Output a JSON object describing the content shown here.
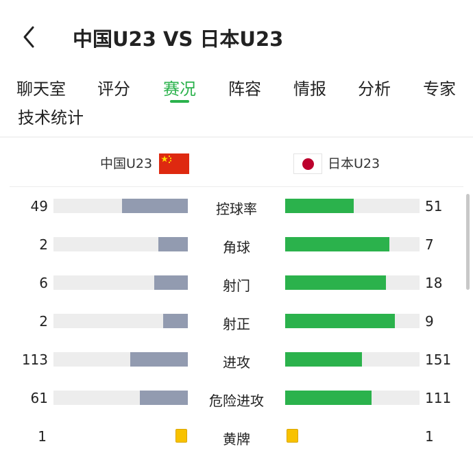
{
  "header": {
    "back_icon": "chevron-left-icon",
    "title": "中国U23 VS 日本U23"
  },
  "tabs": [
    {
      "label": "聊天室",
      "active": false
    },
    {
      "label": "评分",
      "active": false
    },
    {
      "label": "赛况",
      "active": true
    },
    {
      "label": "阵容",
      "active": false
    },
    {
      "label": "情报",
      "active": false
    },
    {
      "label": "分析",
      "active": false
    },
    {
      "label": "专家",
      "active": false
    },
    {
      "label": "技术统计",
      "active": false
    }
  ],
  "teams": {
    "home": {
      "name": "中国U23",
      "flag_icon": "china-flag-icon"
    },
    "away": {
      "name": "日本U23",
      "flag_icon": "japan-flag-icon"
    }
  },
  "colors": {
    "accent": "#2bb24c",
    "home_bar": "#929bb0",
    "away_bar": "#2bb24c",
    "track": "#ededed",
    "yellow_card": "#f8c200"
  },
  "stats": [
    {
      "label": "控球率",
      "home": "49",
      "away": "51"
    },
    {
      "label": "角球",
      "home": "2",
      "away": "7"
    },
    {
      "label": "射门",
      "home": "6",
      "away": "18"
    },
    {
      "label": "射正",
      "home": "2",
      "away": "9"
    },
    {
      "label": "进攻",
      "home": "113",
      "away": "151"
    },
    {
      "label": "危险进攻",
      "home": "61",
      "away": "111"
    },
    {
      "label": "黄牌",
      "home": "1",
      "away": "1",
      "icon": "yellow-card-icon"
    }
  ]
}
